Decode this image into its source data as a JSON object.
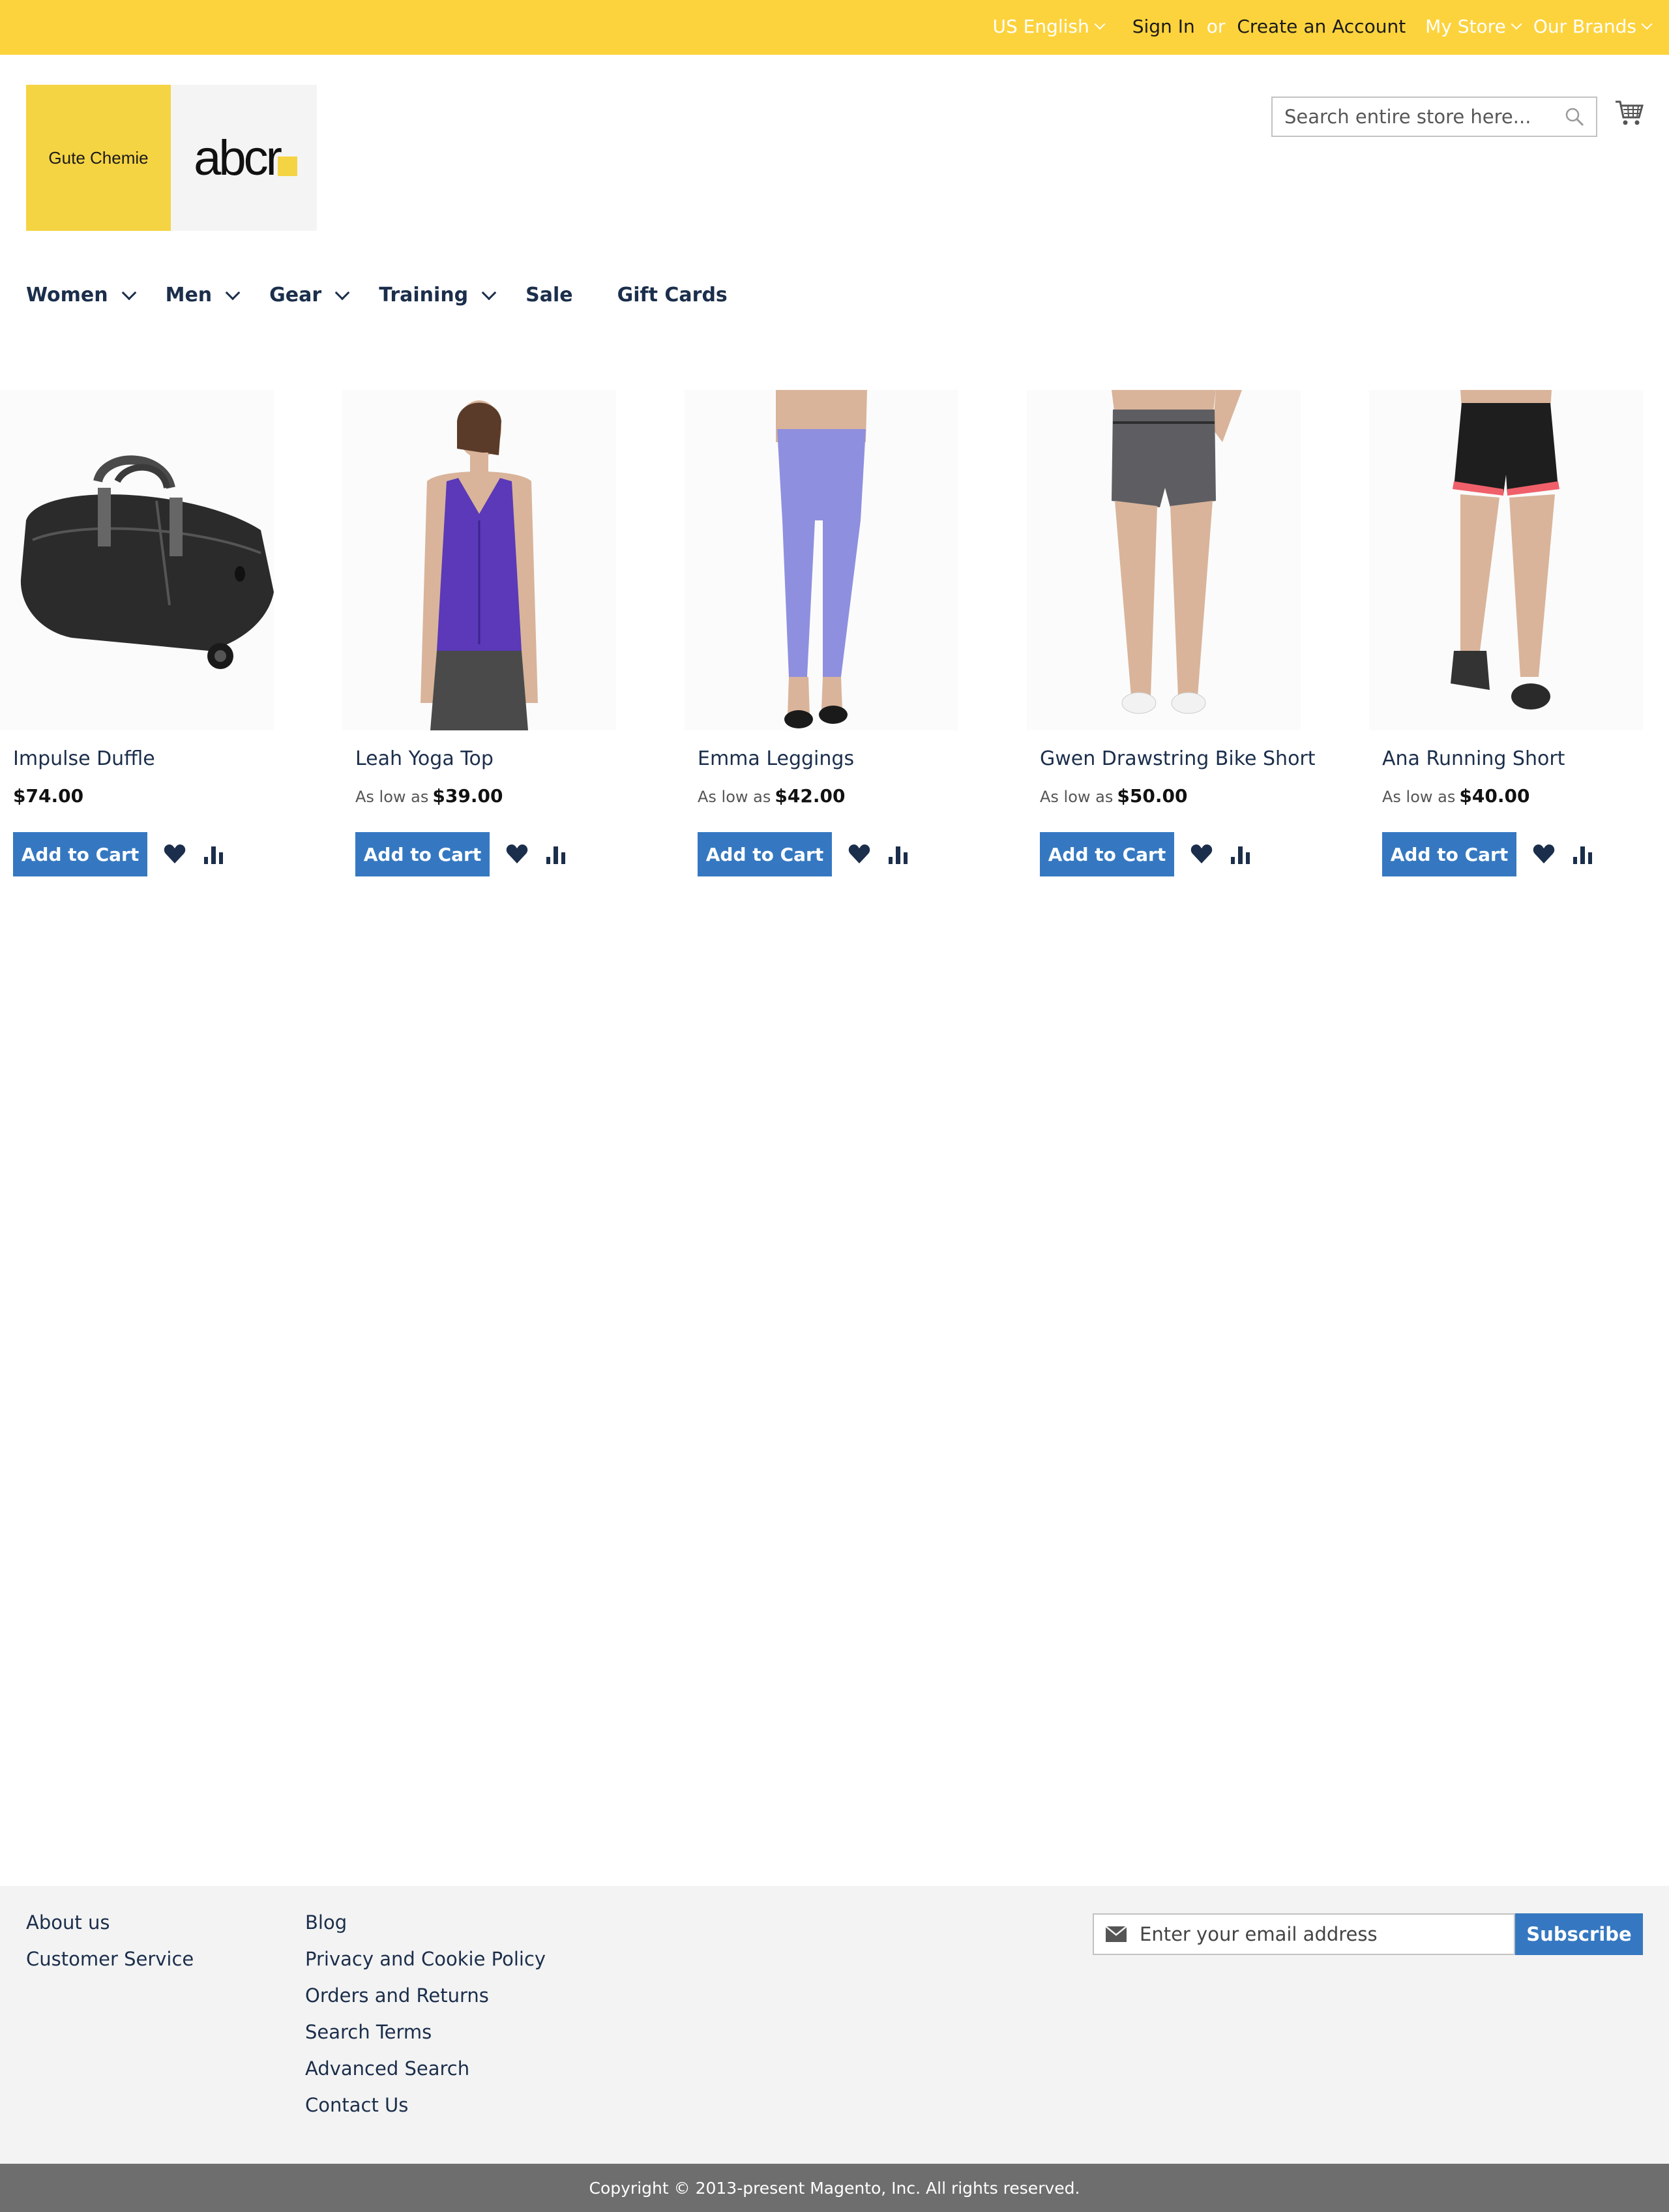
{
  "header": {
    "language": "US English",
    "sign_in": "Sign In",
    "or": "or",
    "create_account": "Create an Account",
    "my_store": "My Store",
    "our_brands": "Our Brands",
    "background_color": "#fdd33d"
  },
  "logo": {
    "left_text": "Gute Chemie",
    "right_text": "abcr"
  },
  "search": {
    "placeholder": "Search entire store here...",
    "icon": "search-icon"
  },
  "cart_icon": "cart-icon",
  "nav": {
    "items": [
      {
        "label": "Women",
        "has_dropdown": true
      },
      {
        "label": "Men",
        "has_dropdown": true
      },
      {
        "label": "Gear",
        "has_dropdown": true
      },
      {
        "label": "Training",
        "has_dropdown": true
      },
      {
        "label": "Sale",
        "has_dropdown": false
      },
      {
        "label": "Gift Cards",
        "has_dropdown": false
      }
    ]
  },
  "products": [
    {
      "name": "Impulse Duffle",
      "price_prefix": "",
      "price": "$74.00",
      "add_to_cart": "Add to Cart",
      "image": "black duffle bag"
    },
    {
      "name": "Leah Yoga Top",
      "price_prefix": "As low as",
      "price": "$39.00",
      "add_to_cart": "Add to Cart",
      "image": "purple yoga tank top"
    },
    {
      "name": "Emma Leggings",
      "price_prefix": "As low as",
      "price": "$42.00",
      "add_to_cart": "Add to Cart",
      "image": "lavender leggings"
    },
    {
      "name": "Gwen Drawstring Bike Short",
      "price_prefix": "As low as",
      "price": "$50.00",
      "add_to_cart": "Add to Cart",
      "image": "gray bike shorts"
    },
    {
      "name": "Ana Running Short",
      "price_prefix": "As low as",
      "price": "$40.00",
      "add_to_cart": "Add to Cart",
      "image": "black running shorts"
    }
  ],
  "footer": {
    "col1": [
      "About us",
      "Customer Service"
    ],
    "col2": [
      "Blog",
      "Privacy and Cookie Policy",
      "Orders and Returns",
      "Search Terms",
      "Advanced Search",
      "Contact Us"
    ],
    "newsletter_placeholder": "Enter your email address",
    "subscribe": "Subscribe",
    "copyright": "Copyright © 2013-present Magento, Inc. All rights reserved."
  },
  "colors": {
    "accent_button": "#3578c1",
    "link": "#1b2e4b",
    "footer_bg": "#f3f3f3",
    "copyright_bg": "#6e6e6e"
  }
}
